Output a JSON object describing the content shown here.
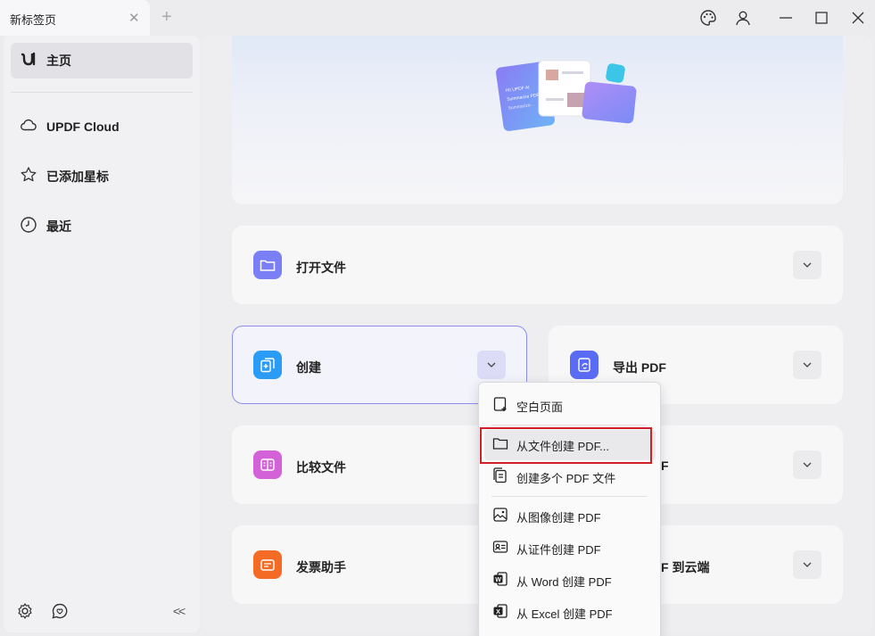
{
  "tab": {
    "title": "新标签页",
    "close": "✕",
    "add": "+"
  },
  "window": {
    "minimize": "—",
    "maximize": "☐",
    "close": "✕"
  },
  "sidebar": {
    "items": [
      {
        "label": "主页",
        "icon": "updf-logo-icon"
      },
      {
        "label": "UPDF Cloud",
        "icon": "cloud-icon"
      },
      {
        "label": "已添加星标",
        "icon": "star-icon"
      },
      {
        "label": "最近",
        "icon": "clock-icon"
      }
    ],
    "collapse": "<<"
  },
  "hero": {
    "card_lines": [
      "Hi! UPDF AI",
      "Summarize PDF",
      "Summarize..."
    ]
  },
  "cards": {
    "open": "打开文件",
    "create": "创建",
    "export": "导出 PDF",
    "compare": "比较文件",
    "hidden_right_1": "F",
    "invoice": "发票助手",
    "hidden_right_2": "F 到云端"
  },
  "dropdown": {
    "items": [
      {
        "label": "空白页面",
        "icon": "blank-page-icon"
      },
      {
        "label": "从文件创建 PDF...",
        "icon": "folder-icon"
      },
      {
        "label": "创建多个 PDF 文件",
        "icon": "multi-file-icon"
      },
      {
        "label": "从图像创建 PDF",
        "icon": "image-icon"
      },
      {
        "label": "从证件创建 PDF",
        "icon": "id-card-icon"
      },
      {
        "label": "从 Word 创建 PDF",
        "icon": "word-icon"
      },
      {
        "label": "从 Excel 创建 PDF",
        "icon": "excel-icon"
      }
    ]
  },
  "colors": {
    "open_icon": "#7b7ff5",
    "create_icon": "#2b9cf6",
    "export_icon": "#5a6cf5",
    "compare_icon": "#d361d8",
    "invoice_icon": "#f36b24",
    "highlight": "#d01f26"
  }
}
